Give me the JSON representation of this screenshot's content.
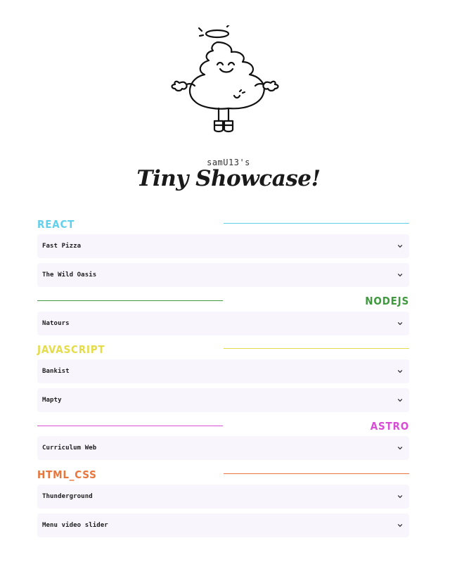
{
  "header": {
    "owner": "samU13's",
    "title": "Tiny Showcase!"
  },
  "sections": [
    {
      "name": "REACT",
      "color": "#62d0ec",
      "align": "left",
      "projects": [
        "Fast Pizza",
        "The Wild Oasis"
      ]
    },
    {
      "name": "NODEJS",
      "color": "#3f9a3d",
      "align": "right",
      "projects": [
        "Natours"
      ]
    },
    {
      "name": "JAVASCRIPT",
      "color": "#e5dc4a",
      "align": "left",
      "projects": [
        "Bankist",
        "Mapty"
      ]
    },
    {
      "name": "ASTRO",
      "color": "#d84ed6",
      "align": "right",
      "projects": [
        "Curriculum Web"
      ]
    },
    {
      "name": "HTML_CSS",
      "color": "#e8753b",
      "align": "left",
      "projects": [
        "Thunderground",
        "Menu video slider"
      ]
    }
  ],
  "icons": {
    "expand": "chevron-down-icon",
    "mascot": "mascot-illustration"
  }
}
